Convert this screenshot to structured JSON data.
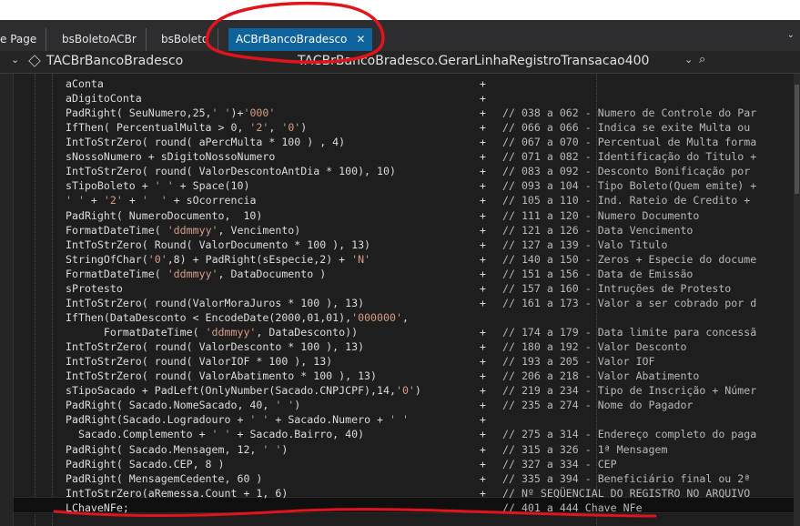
{
  "tabs": [
    {
      "label": "e Page"
    },
    {
      "label": "bsBoletoACBr"
    },
    {
      "label": "bsBoleto"
    },
    {
      "label": "ACBrBancoBradesco",
      "active": true
    }
  ],
  "tab_close": "✕",
  "overflow_glyph": "⌄",
  "nav": {
    "class_name": "TACBrBancoBradesco",
    "method_name": "TACBrBancoBradesco.GerarLinhaRegistroTransacao400",
    "dropdown_glyph": "⌄",
    "split_glyph": "⊢",
    "plus_glyph": "+",
    "dropdown_glyph2": "⌄"
  },
  "code_lines": [
    {
      "code": "aConta",
      "plus": "+",
      "comment": ""
    },
    {
      "code": "aDigitoConta",
      "plus": "+",
      "comment": ""
    },
    {
      "code": "PadRight( SeuNumero,25,' ')+'000'",
      "plus": "+",
      "comment": "// 038 a 062 - Numero de Controle do Par"
    },
    {
      "code": "IfThen( PercentualMulta > 0, '2', '0')",
      "plus": "+",
      "comment": "// 066 a 066 - Indica se exite Multa ou"
    },
    {
      "code": "IntToStrZero( round( aPercMulta * 100 ) , 4)",
      "plus": "+",
      "comment": "// 067 a 070 - Percentual de Multa forma"
    },
    {
      "code": "sNossoNumero + sDigitoNossoNumero",
      "plus": "+",
      "comment": "// 071 a 082 - Identificação do Titulo +"
    },
    {
      "code": "IntToStrZero( round( ValorDescontoAntDia * 100), 10)",
      "plus": "+",
      "comment": "// 083 a 092 - Desconto Bonificação por"
    },
    {
      "code": "sTipoBoleto + ' ' + Space(10)",
      "plus": "+",
      "comment": "// 093 a 104 - Tipo Boleto(Quem emite) +"
    },
    {
      "code": "' ' + '2' + '  ' + sOcorrencia",
      "plus": "+",
      "comment": "// 105 a 110 - Ind. Rateio de Credito +"
    },
    {
      "code": "PadRight( NumeroDocumento,  10)",
      "plus": "+",
      "comment": "// 111 a 120 - Numero Documento"
    },
    {
      "code": "FormatDateTime( 'ddmmyy', Vencimento)",
      "plus": "+",
      "comment": "// 121 a 126 - Data Vencimento"
    },
    {
      "code": "IntToStrZero( Round( ValorDocumento * 100 ), 13)",
      "plus": "+",
      "comment": "// 127 a 139 - Valo Titulo"
    },
    {
      "code": "StringOfChar('0',8) + PadRight(sEspecie,2) + 'N'",
      "plus": "+",
      "comment": "// 140 a 150 - Zeros + Especie do docume"
    },
    {
      "code": "FormatDateTime( 'ddmmyy', DataDocumento )",
      "plus": "+",
      "comment": "// 151 a 156 - Data de Emissão"
    },
    {
      "code": "sProtesto",
      "plus": "+",
      "comment": "// 157 a 160 - Intruções de Protesto"
    },
    {
      "code": "IntToStrZero( round(ValorMoraJuros * 100 ), 13)",
      "plus": "+",
      "comment": "// 161 a 173 - Valor a ser cobrado por d"
    },
    {
      "code": "IfThen(DataDesconto < EncodeDate(2000,01,01),'000000',",
      "plus": "",
      "comment": ""
    },
    {
      "code": "      FormatDateTime( 'ddmmyy', DataDesconto))",
      "plus": "+",
      "comment": "// 174 a 179 - Data limite para concessã"
    },
    {
      "code": "IntToStrZero( round( ValorDesconto * 100 ), 13)",
      "plus": "+",
      "comment": "// 180 a 192 - Valor Desconto"
    },
    {
      "code": "IntToStrZero( round( ValorIOF * 100 ), 13)",
      "plus": "+",
      "comment": "// 193 a 205 - Valor IOF"
    },
    {
      "code": "IntToStrZero( round( ValorAbatimento * 100 ), 13)",
      "plus": "+",
      "comment": "// 206 a 218 - Valor Abatimento"
    },
    {
      "code": "sTipoSacado + PadLeft(OnlyNumber(Sacado.CNPJCPF),14,'0')",
      "plus": "+",
      "comment": "// 219 a 234 - Tipo de Inscrição + Númer"
    },
    {
      "code": "PadRight( Sacado.NomeSacado, 40, ' ')",
      "plus": "+",
      "comment": "// 235 a 274 - Nome do Pagador"
    },
    {
      "code": "PadRight(Sacado.Logradouro + ' ' + Sacado.Numero + ' '",
      "plus": "+",
      "comment": ""
    },
    {
      "code": "  Sacado.Complemento + ' ' + Sacado.Bairro, 40)",
      "plus": "+",
      "comment": "// 275 a 314 - Endereço completo do paga"
    },
    {
      "code": "PadRight( Sacado.Mensagem, 12, ' ')",
      "plus": "+",
      "comment": "// 315 a 326 - 1ª Mensagem"
    },
    {
      "code": "PadRight( Sacado.CEP, 8 )",
      "plus": "+",
      "comment": "// 327 a 334 - CEP"
    },
    {
      "code": "PadRight( MensagemCedente, 60 )",
      "plus": "+",
      "comment": "// 335 a 394 - Beneficiário final ou 2ª"
    },
    {
      "code": "IntToStrZero(aRemessa.Count + 1, 6)",
      "plus": "+",
      "comment": "// Nº SEQÜENCIAL DO REGISTRO NO ARQUIVO"
    },
    {
      "code": "LChaveNFe;",
      "plus": "",
      "comment": "// 401 a 444 Chave NFe"
    }
  ],
  "colors": {
    "editor_bg": "#1e1e1e",
    "tab_active": "#0e639c",
    "string": "#d69d85",
    "annotation": "#e0141c"
  }
}
